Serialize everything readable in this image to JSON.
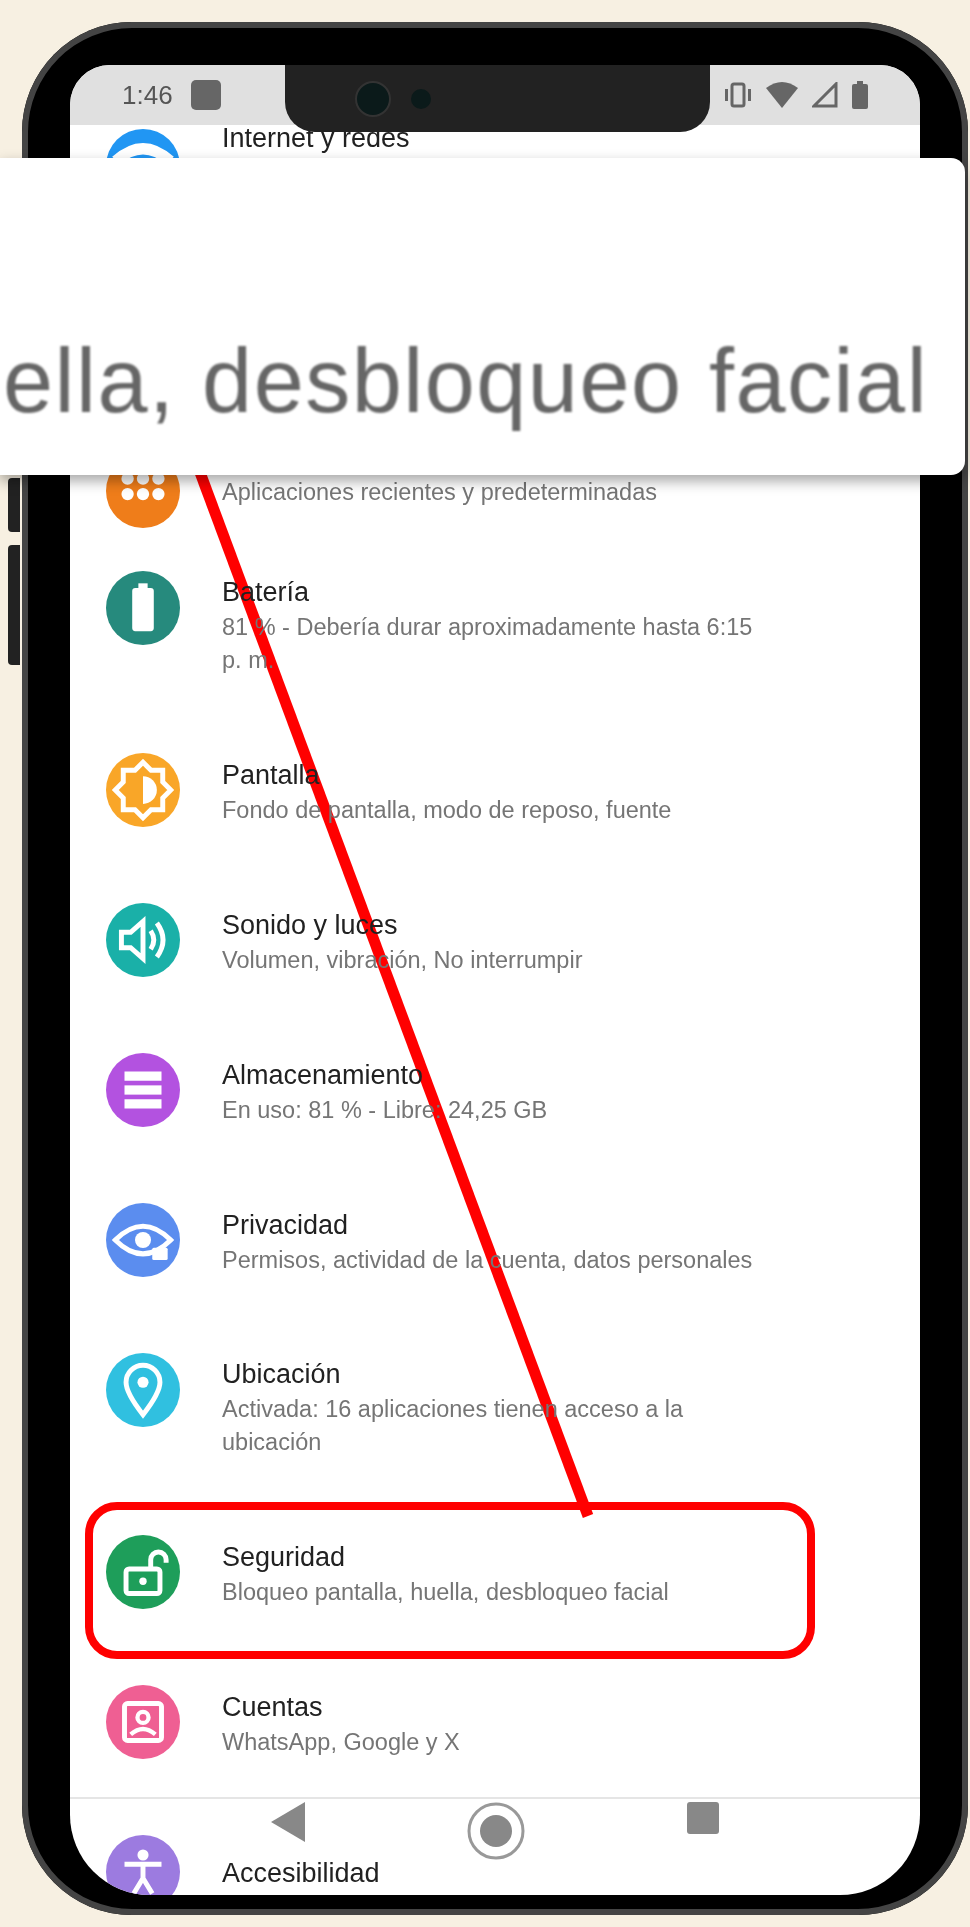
{
  "status_bar": {
    "time": "1:46"
  },
  "magnifier": {
    "text": "ella, desbloqueo facial"
  },
  "settings": [
    {
      "title": "Internet y redes",
      "color": "#2196f3",
      "highlighted": false
    },
    {
      "subtitle": "Aplicaciones recientes y predeterminadas",
      "color": "#ef7d1a",
      "highlighted": false
    },
    {
      "title": "Batería",
      "subtitle": "81 % - Debería durar aproximadamente hasta 6:15 p. m.",
      "color": "#268a7d",
      "highlighted": false
    },
    {
      "title": "Pantalla",
      "subtitle": "Fondo de pantalla, modo de reposo, fuente",
      "color": "#f9a628",
      "highlighted": false
    },
    {
      "title": "Sonido y luces",
      "subtitle": "Volumen, vibración, No interrumpir",
      "color": "#1ab0a8",
      "highlighted": false
    },
    {
      "title": "Almacenamiento",
      "subtitle": "En uso: 81 % - Libre: 24,25 GB",
      "color": "#b352e0",
      "highlighted": false
    },
    {
      "title": "Privacidad",
      "subtitle": "Permisos, actividad de la cuenta, datos personales",
      "color": "#5b8def",
      "highlighted": false
    },
    {
      "title": "Ubicación",
      "subtitle": "Activada: 16 aplicaciones tienen acceso a la ubicación",
      "color": "#30c0e0",
      "highlighted": false
    },
    {
      "title": "Seguridad",
      "subtitle": "Bloqueo pantalla, huella, desbloqueo facial",
      "color": "#1e9e5a",
      "highlighted": true
    },
    {
      "title": "Cuentas",
      "subtitle": "WhatsApp, Google y X",
      "color": "#ef5f93",
      "highlighted": false
    },
    {
      "title": "Accesibilidad",
      "color": "#9c7be0",
      "highlighted": false
    }
  ]
}
